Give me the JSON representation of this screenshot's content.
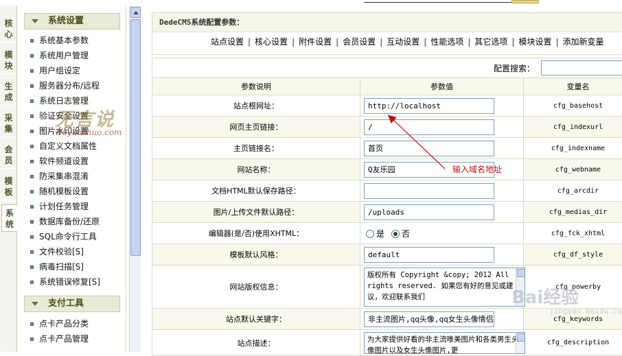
{
  "vertical_tabs": [
    {
      "label": "核\n心",
      "active": false
    },
    {
      "label": "模\n块",
      "active": false
    },
    {
      "label": "生\n成",
      "active": false
    },
    {
      "label": "采\n集",
      "active": false
    },
    {
      "label": "会\n员",
      "active": false
    },
    {
      "label": "模\n板",
      "active": false
    },
    {
      "label": "系\n统",
      "active": true
    }
  ],
  "sidebar": {
    "system_section": "系统设置",
    "system_items": [
      "系统基本参数",
      "系统用户管理",
      "用户组设定",
      "服务器分布/远程",
      "系统日志管理",
      "验证安全设置",
      "图片水印设置",
      "自定义文档属性",
      "软件频道设置",
      "防采集串混淆",
      "随机模板设置",
      "计划任务管理",
      "数据库备份/还原",
      "SQL命令行工具",
      "文件校验[S]",
      "病毒扫描[S]",
      "系统错误修复[S]"
    ],
    "pay_section": "支付工具",
    "pay_items": [
      "点卡产品分类",
      "点卡产品管理"
    ]
  },
  "watermark": {
    "text1": "无言说",
    "text2": "wuyanshuo.com",
    "text3": "Bai经验",
    "text4": "jingyan.baidu.com"
  },
  "header": {
    "title": "DedeCMS系统配置参数：",
    "tabs": [
      "站点设置",
      "核心设置",
      "附件设置",
      "会员设置",
      "互动设置",
      "性能选项",
      "其它选项",
      "模块设置",
      "添加新变量"
    ]
  },
  "search": {
    "label": "配置搜索："
  },
  "table": {
    "headers": [
      "参数说明",
      "参数值",
      "变量名"
    ],
    "rows": [
      {
        "label": "站点根网址：",
        "value": "http://localhost",
        "var": "cfg_basehost"
      },
      {
        "label": "网页主页链接：",
        "value": "/",
        "var": "cfg_indexurl"
      },
      {
        "label": "主页链接名：",
        "value": "首页",
        "var": "cfg_indexname"
      },
      {
        "label": "网站名称：",
        "value": "Q友乐园",
        "var": "cfg_webname"
      },
      {
        "label": "文档HTML默认保存路径：",
        "value": "",
        "var": "cfg_arcdir"
      },
      {
        "label": "图片/上传文件默认路径：",
        "value": "/uploads",
        "var": "cfg_medias_dir"
      },
      {
        "label": "编辑器(是/否)使用XHTML：",
        "radio_yes": "是",
        "radio_no": "否",
        "var": "cfg_fck_xhtml"
      },
      {
        "label": "模板默认风格：",
        "value": "default",
        "var": "cfg_df_style"
      },
      {
        "label": "网站版权信息：",
        "textarea": "版权所有 Copyright &copy; 2012 All rights reserved. 如果您有好的意见或建议，欢迎联系我们",
        "var": "cfg_powerby"
      },
      {
        "label": "站点默认关键字：",
        "value": "非主流图片,qq头像,qq女生头像情侣",
        "var": "cfg_keywords"
      },
      {
        "label": "站点描述：",
        "textarea": "为大家提供好看的非主流唯美图片和各类男生头像图片以及女生头像图片,更",
        "var": "cfg_description"
      }
    ]
  },
  "annotation": "输入域名地址",
  "colors": {
    "annotation": "#c01010",
    "sidebar_header_bg": "#e8ecd6",
    "alt_row": "#f8f9ec"
  }
}
